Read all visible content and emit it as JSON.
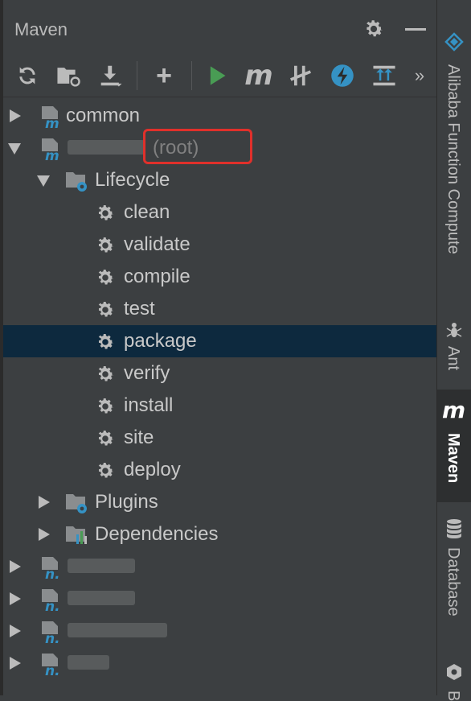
{
  "header": {
    "title": "Maven"
  },
  "toolbar": {
    "icons": [
      "reload-icon",
      "add-maven-project-icon",
      "download-sources-icon",
      "add-icon",
      "run-icon",
      "execute-maven-goal-icon",
      "toggle-offline-icon",
      "skip-tests-icon",
      "show-dependencies-icon",
      "more-icon"
    ],
    "plus": "+",
    "m": "m",
    "more": "»"
  },
  "tree": {
    "common": "common",
    "root_suffix": "(root)",
    "lifecycle": "Lifecycle",
    "goals": [
      "clean",
      "validate",
      "compile",
      "test",
      "package",
      "verify",
      "install",
      "site",
      "deploy"
    ],
    "plugins": "Plugins",
    "dependencies": "Dependencies",
    "selected_goal": "package"
  },
  "sidebar": {
    "tabs": [
      "Alibaba Function Compute",
      "Ant",
      "Maven",
      "Database",
      "B"
    ],
    "active": "Maven",
    "maven_icon": "m"
  },
  "colors": {
    "accent_run": "#499c54",
    "selection": "#0d293e",
    "highlight_box": "#e0302b",
    "function_compute": "#3592c4"
  }
}
